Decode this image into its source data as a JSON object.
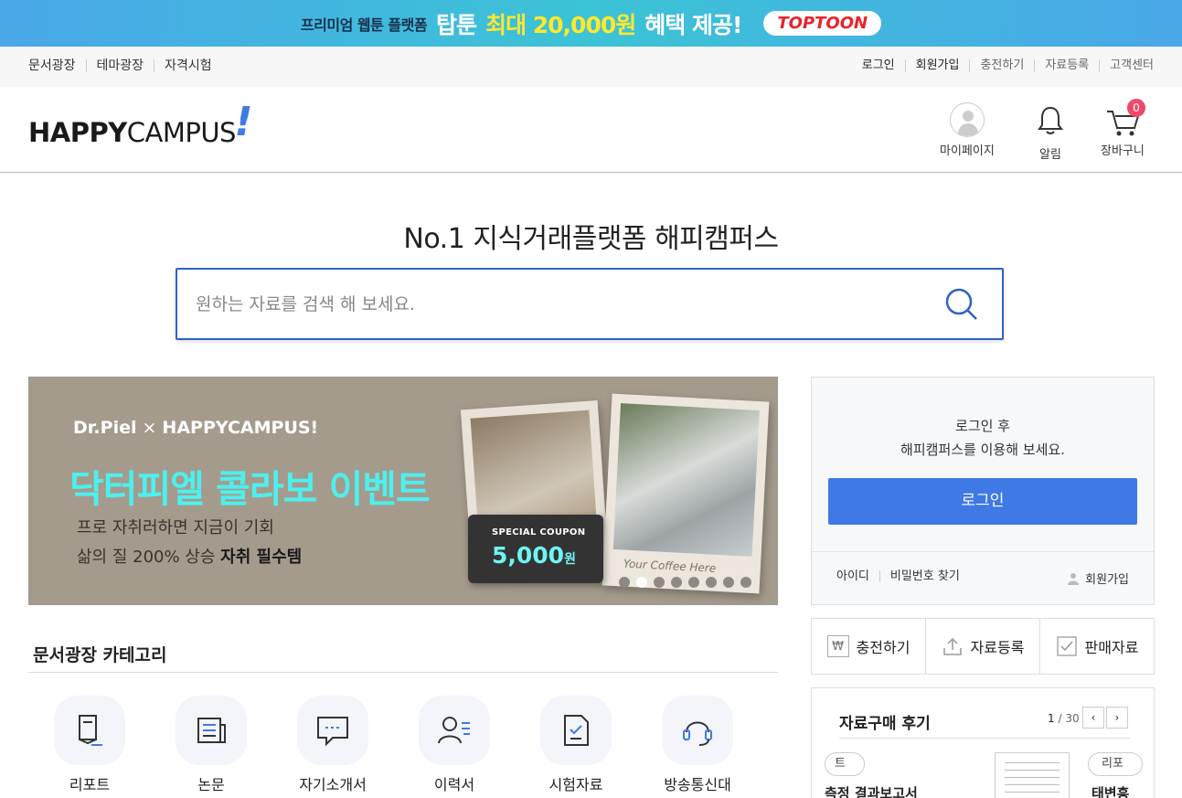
{
  "promo": {
    "small": "프리미엄 웹툰 플랫폼",
    "brand": "탑툰",
    "highlight": "최대 20,000원",
    "rest": "혜택 제공!",
    "pill": "TOPTOON"
  },
  "util_nav": {
    "left": [
      "문서광장",
      "테마광장",
      "자격시험"
    ],
    "right": [
      {
        "label": "로그인",
        "dark": true
      },
      {
        "label": "회원가입",
        "dark": true
      },
      {
        "label": "충전하기",
        "dark": false
      },
      {
        "label": "자료등록",
        "dark": false
      },
      {
        "label": "고객센터",
        "dark": false
      }
    ]
  },
  "header": {
    "logo_bold": "HAPPY",
    "logo_light": "CAMPUS",
    "logo_mark": "!",
    "mypage": "마이페이지",
    "alarm": "알림",
    "cart": "장바구니",
    "cart_count": "0"
  },
  "hero": {
    "tagline": "No.1 지식거래플랫폼 해피캠퍼스",
    "search_placeholder": "원하는 자료를 검색 해 보세요."
  },
  "banner": {
    "brand_left": "Dr.Piel",
    "brand_x": "×",
    "brand_right": "HAPPYCAMPUS!",
    "title": "닥터피엘 콜라보 이벤트",
    "sub1": "프로 자취러하면 지금이 기회",
    "sub2_pre": "삶의 질 200% 상승 ",
    "sub2_bold": "자취 필수템",
    "coupon_label": "SPECIAL COUPON",
    "coupon_value": "5,000",
    "coupon_unit": "원",
    "signature": "Your Coffee Here",
    "slides": 8,
    "active_slide": 2
  },
  "categories": {
    "title": "문서광장 카테고리",
    "items": [
      "리포트",
      "논문",
      "자기소개서",
      "이력서",
      "시험자료",
      "방송통신대"
    ]
  },
  "login_box": {
    "msg1": "로그인 후",
    "msg2": "해피캠퍼스를 이용해 보세요.",
    "button": "로그인",
    "link_id": "아이디",
    "link_pw": "비밀번호 찾기",
    "join": "회원가입"
  },
  "quick": {
    "charge": "충전하기",
    "upload": "자료등록",
    "sales": "판매자료"
  },
  "reviews": {
    "title": "자료구매 후기",
    "page_current": "1",
    "page_total": "/ 30",
    "tag_left": "트",
    "tag_right": "리포",
    "name_left": "측정 결과보고서",
    "name_right": "태변흥"
  },
  "colors": {
    "accent": "#3e79e5",
    "search_border": "#2e62c4",
    "logo_mark": "#3f7be2",
    "banner_title": "#4cf0ee",
    "badge": "#f0486b"
  }
}
